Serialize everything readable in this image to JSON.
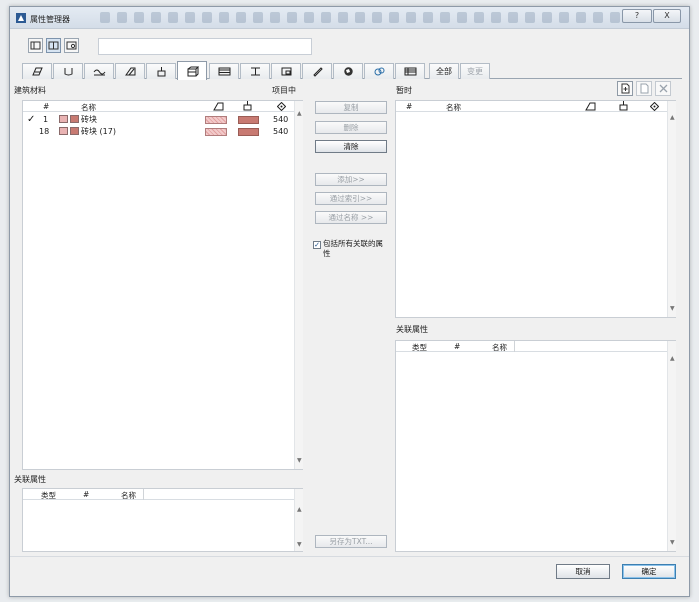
{
  "window": {
    "title": "属性管理器",
    "help_label": "?",
    "close_label": "X"
  },
  "tabs": [
    {
      "icon": "fill-icon"
    },
    {
      "icon": "line-type-icon"
    },
    {
      "icon": "line-icon"
    },
    {
      "icon": "surface-icon"
    },
    {
      "icon": "pen-icon"
    },
    {
      "icon": "building-material-icon",
      "active": true
    },
    {
      "icon": "composite-icon"
    },
    {
      "icon": "profile-icon"
    },
    {
      "icon": "zone-icon"
    },
    {
      "icon": "pencil-icon"
    },
    {
      "icon": "globe-icon"
    },
    {
      "icon": "mep-icon"
    },
    {
      "icon": "grid-icon"
    },
    {
      "label": "全部"
    },
    {
      "label": "变更",
      "disabled": true
    }
  ],
  "left_panel": {
    "title": "建筑材料",
    "right_label": "项目中",
    "columns": {
      "num": "#",
      "name": "名称"
    },
    "rows": [
      {
        "checked": "✓",
        "num": "1",
        "name": "砖块",
        "count": "540",
        "fill_color": "#e9b3b3",
        "surface_color": "#c87a72"
      },
      {
        "checked": "",
        "num": "18",
        "name": "砖块 (17)",
        "count": "540",
        "fill_color": "#e9b3b3",
        "surface_color": "#c87a72"
      }
    ]
  },
  "left_assoc": {
    "title": "关联属性",
    "columns": {
      "type": "类型",
      "num": "#",
      "name": "名称"
    }
  },
  "middle": {
    "copy_label": "复制",
    "delete_label": "删除",
    "clear_label": "清除",
    "add_label": "添加>>",
    "by_index_label": "通过索引>>",
    "by_name_label": "通过名称 >>",
    "include_all_label": "包括所有关联的属性",
    "save_txt_label": "另存为TXT..."
  },
  "right_panel": {
    "title": "暂时",
    "columns": {
      "num": "#",
      "name": "名称"
    }
  },
  "right_assoc": {
    "title": "关联属性",
    "columns": {
      "type": "类型",
      "num": "#",
      "name": "名称"
    }
  },
  "footer": {
    "cancel_label": "取消",
    "ok_label": "确定"
  }
}
